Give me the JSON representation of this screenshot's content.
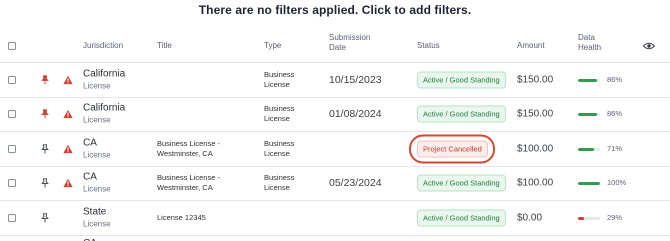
{
  "banner": {
    "text": "There are no filters applied. Click to add filters."
  },
  "columns": {
    "jurisdiction": "Jurisdiction",
    "title": "Title",
    "type": "Type",
    "submission_date_1": "Submission",
    "submission_date_2": "Date",
    "status": "Status",
    "amount": "Amount",
    "data_health_1": "Data",
    "data_health_2": "Health"
  },
  "icons": {
    "pinned": "pushpin-filled-icon",
    "unpinned": "pushpin-outline-icon",
    "alert": "warning-triangle-icon",
    "columns": "eye-icon"
  },
  "colors": {
    "pin_active": "#d23b2e",
    "alert": "#d23b2e",
    "status_good": "#227a3d",
    "status_cancel": "#c0392b",
    "highlight_ring": "#d9462f",
    "health_good": "#2e9d4f",
    "health_bad": "#d23b2e"
  },
  "rows": [
    {
      "pinned": true,
      "alert": true,
      "jurisdiction": "California",
      "sub": "License",
      "title_1": "",
      "title_2": "",
      "type_1": "Business",
      "type_2": "License",
      "date": "10/15/2023",
      "status": "Active / Good Standing",
      "status_kind": "good",
      "amount": "$150.00",
      "health_value": 0.86,
      "health_label": "86%"
    },
    {
      "pinned": true,
      "alert": true,
      "jurisdiction": "California",
      "sub": "License",
      "title_1": "",
      "title_2": "",
      "type_1": "Business",
      "type_2": "License",
      "date": "01/08/2024",
      "status": "Active / Good Standing",
      "status_kind": "good",
      "amount": "$150.00",
      "health_value": 0.86,
      "health_label": "86%"
    },
    {
      "pinned": false,
      "alert": true,
      "jurisdiction": "CA",
      "sub": "License",
      "title_1": "Business License -",
      "title_2": "Westminster, CA",
      "type_1": "Business",
      "type_2": "License",
      "date": "",
      "status": "Project Cancelled",
      "status_kind": "cancel",
      "amount": "$100.00",
      "health_value": 0.71,
      "health_label": "71%"
    },
    {
      "pinned": false,
      "alert": true,
      "jurisdiction": "CA",
      "sub": "License",
      "title_1": "Business License -",
      "title_2": "Westminster, CA",
      "type_1": "Business",
      "type_2": "License",
      "date": "05/23/2024",
      "status": "Active / Good Standing",
      "status_kind": "good",
      "amount": "$100.00",
      "health_value": 1.0,
      "health_label": "100%"
    },
    {
      "pinned": false,
      "alert": false,
      "jurisdiction": "State",
      "sub": "License",
      "title_1": "License 12345",
      "title_2": "",
      "type_1": "",
      "type_2": "",
      "date": "",
      "status": "Active / Good Standing",
      "status_kind": "good",
      "amount": "$0.00",
      "health_value": 0.29,
      "health_label": "29%"
    }
  ],
  "partial_row": {
    "jurisdiction": "CA"
  }
}
